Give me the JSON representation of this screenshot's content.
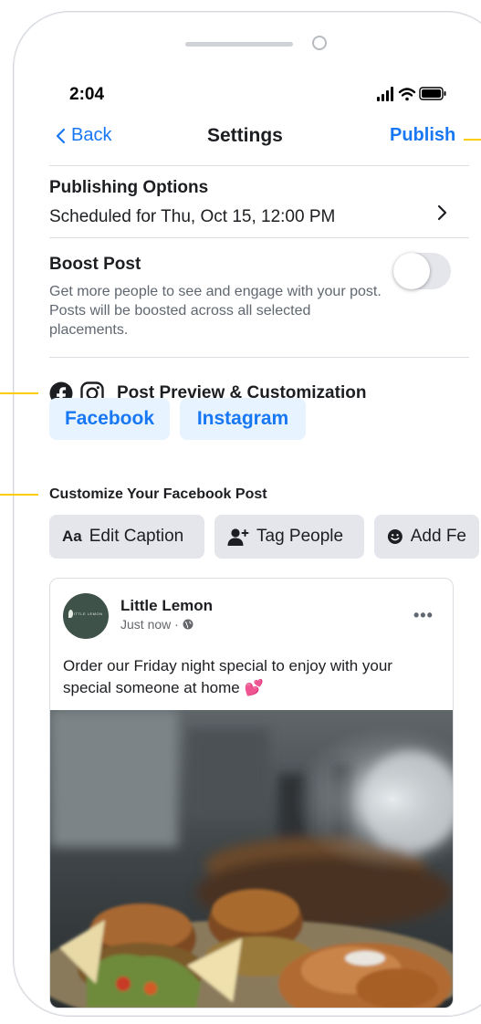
{
  "status": {
    "time": "2:04"
  },
  "nav": {
    "back_label": "Back",
    "title": "Settings",
    "publish_label": "Publish"
  },
  "publishing": {
    "title": "Publishing Options",
    "value": "Scheduled for Thu, Oct 15, 12:00 PM"
  },
  "boost": {
    "title": "Boost Post",
    "description": "Get more people to see and engage with your post. Posts will be boosted across all selected placements.",
    "enabled": false
  },
  "preview": {
    "title": "Post Preview & Customization",
    "tabs": [
      "Facebook",
      "Instagram"
    ],
    "selected_tab": "Facebook"
  },
  "customize": {
    "title": "Customize Your Facebook Post",
    "chips": [
      {
        "icon": "Aa",
        "label": "Edit Caption"
      },
      {
        "icon": "tag-people-icon",
        "label": "Tag People"
      },
      {
        "icon": "smiley-icon",
        "label": "Add Fe"
      }
    ]
  },
  "post": {
    "page_name": "Little Lemon",
    "avatar_text": "LITTLE LEMON",
    "time": "Just now · ",
    "text": "Order our Friday night special to enjoy with your special someone at home 💕",
    "photo_icon": "food-photo"
  },
  "colors": {
    "accent": "#1877f2",
    "tab_bg": "#e7f3ff",
    "chip_bg": "#e4e6eb",
    "callout": "#ffcc00"
  }
}
